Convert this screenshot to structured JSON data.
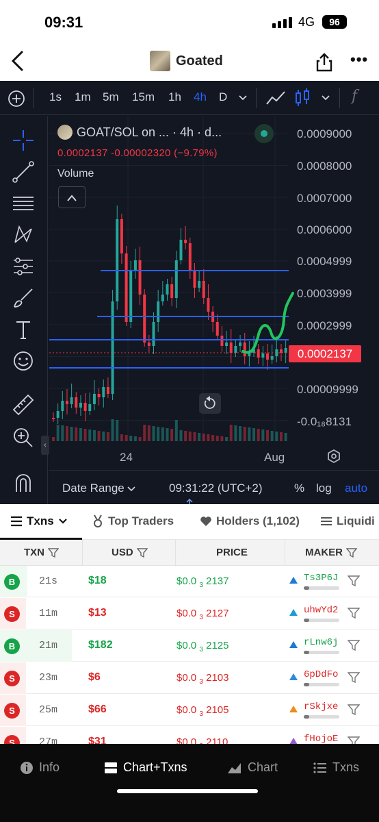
{
  "status_bar": {
    "time": "09:31",
    "network": "4G",
    "battery": "96"
  },
  "nav": {
    "title": "Goated"
  },
  "timeframes": [
    "1s",
    "1m",
    "5m",
    "15m",
    "1h",
    "4h",
    "D"
  ],
  "active_timeframe": "4h",
  "chart_header": {
    "symbol": "GOAT/SOL on ... · 4h · d...",
    "ohlc": "0.0002137  -0.00002320 (−9.79%)",
    "volume_label": "Volume"
  },
  "price_axis": [
    "0.0009000",
    "0.0008000",
    "0.0007000",
    "0.0006000",
    "0.0004999",
    "0.0003999",
    "0.0002999",
    "0.0002137",
    "0.00009999",
    "-0.0₁₈8131"
  ],
  "current_price": "0.0002137",
  "time_axis": [
    "24",
    "Aug"
  ],
  "chart_footer": {
    "date_range": "Date Range",
    "clock": "09:31:22 (UTC+2)",
    "pct": "%",
    "log": "log",
    "auto": "auto"
  },
  "tabs": [
    "Txns",
    "Top Traders",
    "Holders (1,102)",
    "Liquidi"
  ],
  "table": {
    "headers": [
      "TXN",
      "USD",
      "PRICE",
      "MAKER"
    ],
    "rows": [
      {
        "side": "B",
        "age": "21s",
        "usd": "$18",
        "price": "$0.0",
        "sub": "3",
        "price_tail": "2137",
        "maker": "Ts3P6J",
        "color": "#16a34a"
      },
      {
        "side": "S",
        "age": "11m",
        "usd": "$13",
        "price": "$0.0",
        "sub": "3",
        "price_tail": "2127",
        "maker": "uhwYd2",
        "color": "#dc2626"
      },
      {
        "side": "B",
        "age": "21m",
        "usd": "$182",
        "price": "$0.0",
        "sub": "3",
        "price_tail": "2125",
        "maker": "rLnw6j",
        "color": "#16a34a"
      },
      {
        "side": "S",
        "age": "23m",
        "usd": "$6",
        "price": "$0.0",
        "sub": "3",
        "price_tail": "2103",
        "maker": "6pDdFo",
        "color": "#dc2626"
      },
      {
        "side": "S",
        "age": "25m",
        "usd": "$66",
        "price": "$0.0",
        "sub": "3",
        "price_tail": "2105",
        "maker": "rSkjxe",
        "color": "#dc2626"
      },
      {
        "side": "S",
        "age": "27m",
        "usd": "$31",
        "price": "$0.0",
        "sub": "3",
        "price_tail": "2110",
        "maker": "fHojoE",
        "color": "#dc2626"
      }
    ]
  },
  "bottom_nav": [
    "Info",
    "Chart+Txns",
    "Chart",
    "Txns"
  ],
  "colors": {
    "up": "#26a69a",
    "down": "#f23645",
    "accent": "#2962ff",
    "drawing_line": "#2962ff",
    "drawing_squiggle": "#22c55e"
  },
  "chart_data": {
    "type": "candlestick",
    "symbol": "GOAT/SOL",
    "interval": "4h",
    "y_axis_ticks": [
      "0.0009000",
      "0.0008000",
      "0.0007000",
      "0.0006000",
      "0.0004999",
      "0.0003999",
      "0.0002999",
      "0.00009999",
      "-0.0₁₈8131"
    ],
    "last_price": "0.0002137",
    "change": "-0.00002320",
    "change_pct": "−9.79%",
    "x_ticks": [
      "24",
      "Aug"
    ],
    "horizontal_levels": [
      0.00045,
      0.0003,
      0.00023,
      0.00014
    ]
  }
}
